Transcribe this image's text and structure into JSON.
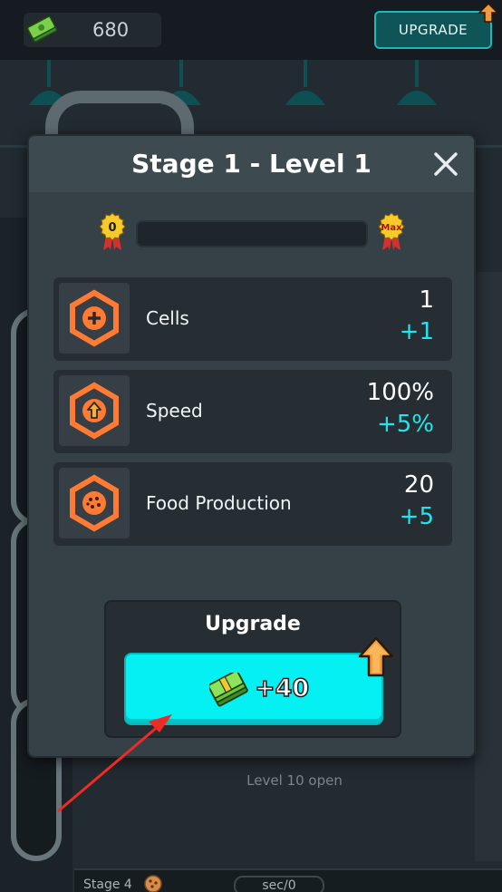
{
  "hud": {
    "money": "680",
    "upgrade_label": "UPGRADE"
  },
  "background": {
    "level_open": "Level 10 open",
    "stage_label": "Stage 4",
    "rate_label": "sec/0"
  },
  "modal": {
    "title": "Stage 1 - Level 1",
    "progress": {
      "min_label": "0",
      "max_label": "Max",
      "fill_fraction": 0
    },
    "stats": [
      {
        "label": "Cells",
        "value": "1",
        "delta": "+1",
        "icon": "plus-hex-icon"
      },
      {
        "label": "Speed",
        "value": "100%",
        "delta": "+5%",
        "icon": "arrow-up-hex-icon"
      },
      {
        "label": "Food Production",
        "value": "20",
        "delta": "+5",
        "icon": "cookie-hex-icon"
      }
    ],
    "upgrade": {
      "title": "Upgrade",
      "price": "+40"
    }
  },
  "colors": {
    "accent_cyan": "#05f0f2",
    "delta_cyan": "#20e5ee",
    "icon_orange": "#ff7a33",
    "modal_bg": "#364147"
  }
}
